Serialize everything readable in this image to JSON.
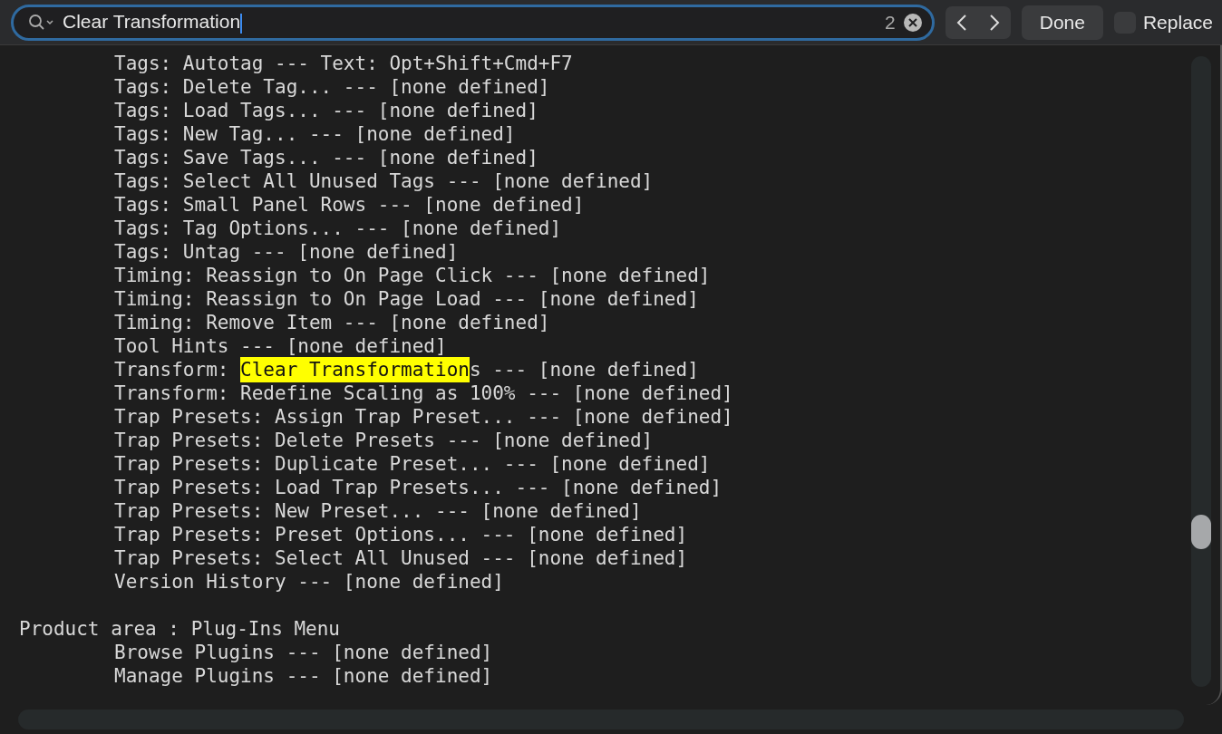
{
  "find_bar": {
    "query": "Clear Transformation",
    "match_count": "2",
    "done_label": "Done",
    "replace": {
      "label": "Replace",
      "checked": false
    }
  },
  "sections": [
    {
      "lines": [
        {
          "text": "Tags: Autotag --- Text: Opt+Shift+Cmd+F7"
        },
        {
          "text": "Tags: Delete Tag... --- [none defined]"
        },
        {
          "text": "Tags: Load Tags... --- [none defined]"
        },
        {
          "text": "Tags: New Tag... --- [none defined]"
        },
        {
          "text": "Tags: Save Tags... --- [none defined]"
        },
        {
          "text": "Tags: Select All Unused Tags --- [none defined]"
        },
        {
          "text": "Tags: Small Panel Rows --- [none defined]"
        },
        {
          "text": "Tags: Tag Options... --- [none defined]"
        },
        {
          "text": "Tags: Untag --- [none defined]"
        },
        {
          "text": "Timing: Reassign to On Page Click --- [none defined]"
        },
        {
          "text": "Timing: Reassign to On Page Load --- [none defined]"
        },
        {
          "text": "Timing: Remove Item --- [none defined]"
        },
        {
          "text": "Tool Hints --- [none defined]"
        },
        {
          "text": "Transform: ",
          "match": "Clear Transformation",
          "after": "s --- [none defined]"
        },
        {
          "text": "Transform: Redefine Scaling as 100% --- [none defined]"
        },
        {
          "text": "Trap Presets: Assign Trap Preset... --- [none defined]"
        },
        {
          "text": "Trap Presets: Delete Presets --- [none defined]"
        },
        {
          "text": "Trap Presets: Duplicate Preset... --- [none defined]"
        },
        {
          "text": "Trap Presets: Load Trap Presets... --- [none defined]"
        },
        {
          "text": "Trap Presets: New Preset... --- [none defined]"
        },
        {
          "text": "Trap Presets: Preset Options... --- [none defined]"
        },
        {
          "text": "Trap Presets: Select All Unused --- [none defined]"
        },
        {
          "text": "Version History --- [none defined]"
        }
      ]
    },
    {
      "heading": "Product area : Plug-Ins Menu",
      "lines": [
        {
          "text": "Browse Plugins --- [none defined]"
        },
        {
          "text": "Manage Plugins --- [none defined]"
        }
      ]
    }
  ]
}
